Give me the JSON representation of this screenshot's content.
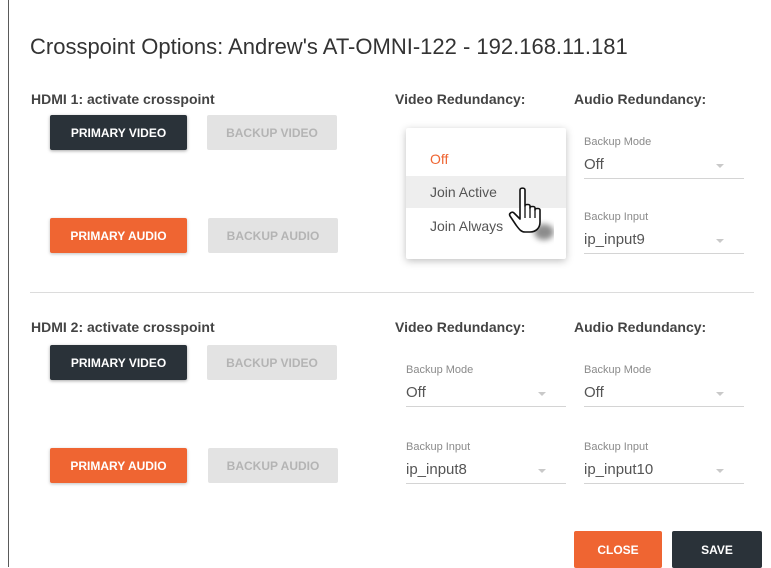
{
  "dialog": {
    "title": "Crosspoint Options: Andrew's AT-OMNI-122 - 192.168.11.181"
  },
  "hdmi1": {
    "heading": "HDMI 1: activate crosspoint",
    "video_redundancy_heading": "Video Redundancy:",
    "audio_redundancy_heading": "Audio Redundancy:",
    "primary_video": "PRIMARY VIDEO",
    "backup_video": "BACKUP VIDEO",
    "primary_audio": "PRIMARY AUDIO",
    "backup_audio": "BACKUP AUDIO",
    "video_mode_menu": {
      "options": [
        "Off",
        "Join Active",
        "Join Always"
      ],
      "selected": "Off",
      "hovered": "Join Active"
    },
    "audio_backup_mode": {
      "label": "Backup Mode",
      "value": "Off"
    },
    "audio_backup_input": {
      "label": "Backup Input",
      "value": "ip_input9"
    }
  },
  "hdmi2": {
    "heading": "HDMI 2: activate crosspoint",
    "video_redundancy_heading": "Video Redundancy:",
    "audio_redundancy_heading": "Audio Redundancy:",
    "primary_video": "PRIMARY VIDEO",
    "backup_video": "BACKUP VIDEO",
    "primary_audio": "PRIMARY AUDIO",
    "backup_audio": "BACKUP AUDIO",
    "video_backup_mode": {
      "label": "Backup Mode",
      "value": "Off"
    },
    "video_backup_input": {
      "label": "Backup Input",
      "value": "ip_input8"
    },
    "audio_backup_mode": {
      "label": "Backup Mode",
      "value": "Off"
    },
    "audio_backup_input": {
      "label": "Backup Input",
      "value": "ip_input10"
    }
  },
  "footer": {
    "close": "CLOSE",
    "save": "SAVE"
  },
  "colors": {
    "accent": "#ef6532",
    "dark_button": "#2a3239",
    "disabled_button": "#e3e3e3"
  },
  "icons": {
    "cursor": "hand-pointer-icon",
    "dropdown": "caret-down-icon"
  }
}
